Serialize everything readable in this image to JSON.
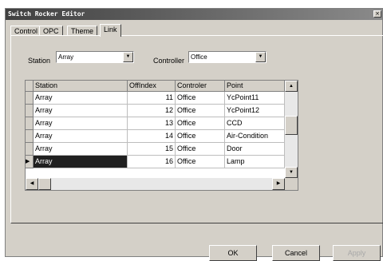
{
  "window": {
    "title": "Switch Rocker Editor",
    "close_glyph": "×"
  },
  "tabs": [
    "Control",
    "OPC",
    "Theme",
    "Link"
  ],
  "filters": {
    "station_label": "Station",
    "station_value": "Array",
    "controller_label": "Controller",
    "controller_value": "Office"
  },
  "grid": {
    "columns": [
      "Station",
      "OffIndex",
      "Controler",
      "Point"
    ],
    "rows": [
      {
        "station": "Array",
        "offindex": "11",
        "controller": "Office",
        "point": "YcPoint11"
      },
      {
        "station": "Array",
        "offindex": "12",
        "controller": "Office",
        "point": "YcPoint12"
      },
      {
        "station": "Array",
        "offindex": "13",
        "controller": "Office",
        "point": "CCD"
      },
      {
        "station": "Array",
        "offindex": "14",
        "controller": "Office",
        "point": "Air-Condition"
      },
      {
        "station": "Array",
        "offindex": "15",
        "controller": "Office",
        "point": "Door"
      },
      {
        "station": "Array",
        "offindex": "16",
        "controller": "Office",
        "point": "Lamp"
      }
    ],
    "selected_row_marker": "▶"
  },
  "buttons": {
    "ok": "OK",
    "cancel": "Cancel",
    "apply": "Apply"
  },
  "icons": {
    "dropdown_arrow": "▼",
    "scroll_up": "▲",
    "scroll_down": "▼",
    "scroll_left": "◀",
    "scroll_right": "▶"
  }
}
